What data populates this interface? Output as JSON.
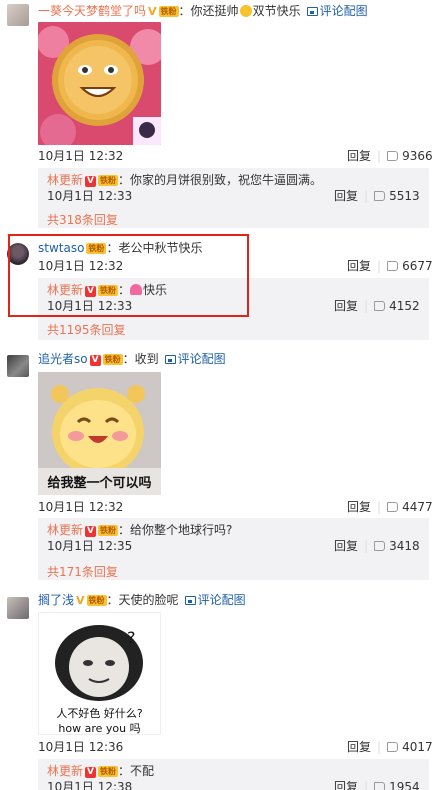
{
  "comments": [
    {
      "user": "一葵今天梦鹤堂了吗",
      "text": "你还挺帅",
      "text_suffix": "双节快乐",
      "pic_link": "评论配图",
      "image_label": "mooncake-face",
      "time": "10月1日 12:32",
      "reply_label": "回复",
      "likes": "9366",
      "reply": {
        "user": "林更新",
        "text": "你家的月饼很别致，祝您牛逼圆满。",
        "time": "10月1日 12:33",
        "reply_label": "回复",
        "likes": "5513"
      },
      "more": "共318条回复"
    },
    {
      "user": "stwtaso",
      "text": "老公中秋节快乐",
      "time": "10月1日 12:32",
      "reply_label": "回复",
      "likes": "6677",
      "reply": {
        "user": "林更新",
        "text": "快乐",
        "time": "10月1日 12:33",
        "reply_label": "回复",
        "likes": "4152"
      },
      "more": "共1195条回复"
    },
    {
      "user": "追光者so",
      "text": "收到",
      "pic_link": "评论配图",
      "image_caption": "给我整一个可以吗",
      "time": "10月1日 12:32",
      "reply_label": "回复",
      "likes": "4477",
      "reply": {
        "user": "林更新",
        "text": "给你整个地球行吗?",
        "time": "10月1日 12:35",
        "reply_label": "回复",
        "likes": "3418"
      },
      "more": "共171条回复"
    },
    {
      "user": "搁了浅",
      "text": "天使的脸呢",
      "pic_link": "评论配图",
      "image_caption_1": "人不好色 好什么?",
      "image_caption_2": "how are you 吗",
      "time": "10月1日 12:36",
      "reply_label": "回复",
      "likes": "4017",
      "reply": {
        "user": "林更新",
        "text": "不配",
        "time": "10月1日 12:38",
        "reply_label": "回复",
        "likes": "1954"
      }
    }
  ],
  "badges": {
    "v": "V",
    "fans": "铁粉"
  },
  "colors": {
    "username": "#eb7350",
    "link": "#1e5faa",
    "highlight": "#e2231a",
    "reply_bg": "#f2f2f5"
  }
}
